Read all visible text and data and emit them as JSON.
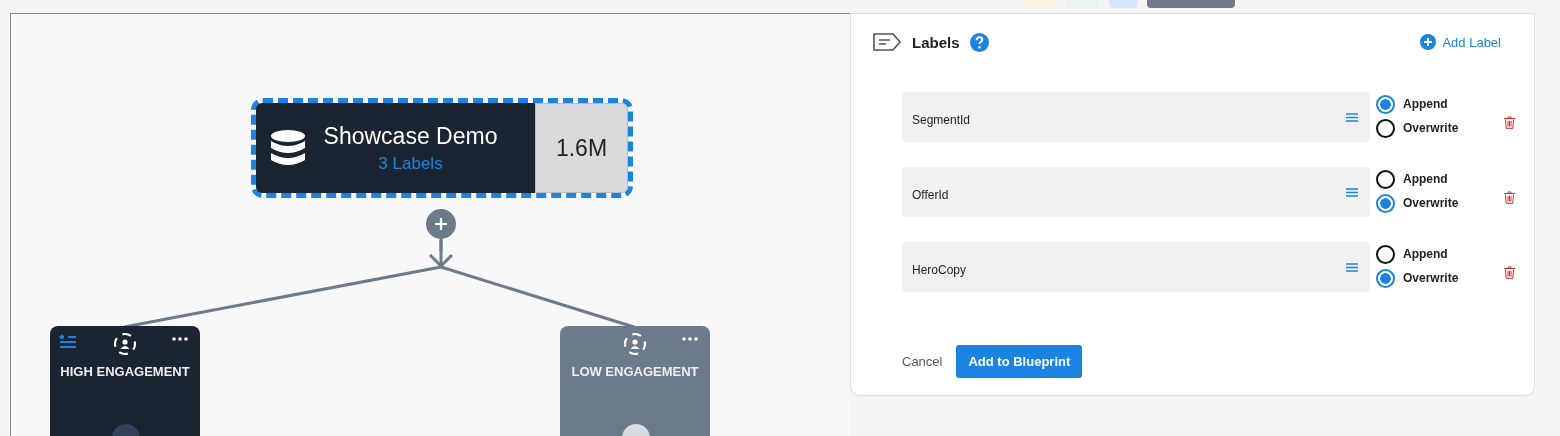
{
  "canvas": {
    "source_node": {
      "title": "Showcase Demo",
      "subtitle": "3 Labels",
      "count": "1.6M",
      "selected": true
    },
    "segments": [
      {
        "title": "HIGH ENGAGEMENT",
        "kind": "active"
      },
      {
        "title": "LOW ENGAGEMENT",
        "kind": "inactive"
      }
    ]
  },
  "labels_panel": {
    "title": "Labels",
    "add_button": "Add Label",
    "labels": [
      {
        "name": "SegmentId",
        "options": [
          {
            "label": "Append",
            "selected": true
          },
          {
            "label": "Overwrite",
            "selected": false
          }
        ]
      },
      {
        "name": "OfferId",
        "options": [
          {
            "label": "Append",
            "selected": false
          },
          {
            "label": "Overwrite",
            "selected": true
          }
        ]
      },
      {
        "name": "HeroCopy",
        "options": [
          {
            "label": "Append",
            "selected": false
          },
          {
            "label": "Overwrite",
            "selected": true
          }
        ]
      }
    ],
    "cancel": "Cancel",
    "submit": "Add to Blueprint"
  }
}
